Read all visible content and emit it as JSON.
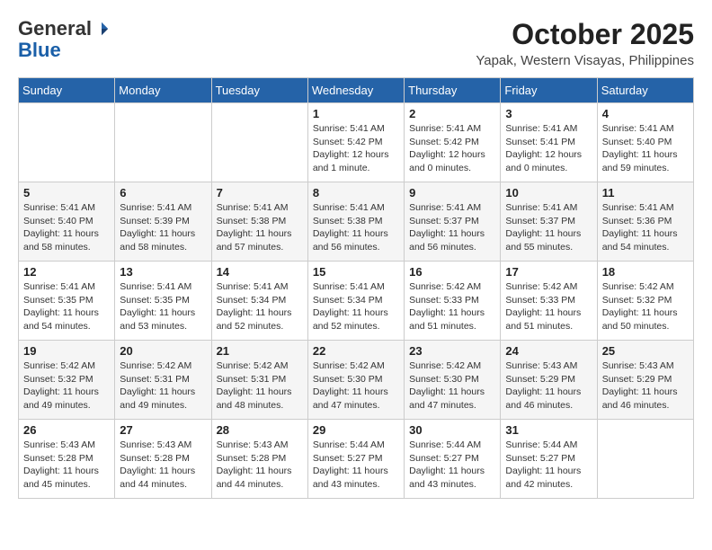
{
  "header": {
    "logo_general": "General",
    "logo_blue": "Blue",
    "month_title": "October 2025",
    "location": "Yapak, Western Visayas, Philippines"
  },
  "weekdays": [
    "Sunday",
    "Monday",
    "Tuesday",
    "Wednesday",
    "Thursday",
    "Friday",
    "Saturday"
  ],
  "weeks": [
    [
      {
        "day": "",
        "sunrise": "",
        "sunset": "",
        "daylight": ""
      },
      {
        "day": "",
        "sunrise": "",
        "sunset": "",
        "daylight": ""
      },
      {
        "day": "",
        "sunrise": "",
        "sunset": "",
        "daylight": ""
      },
      {
        "day": "1",
        "sunrise": "Sunrise: 5:41 AM",
        "sunset": "Sunset: 5:42 PM",
        "daylight": "Daylight: 12 hours and 1 minute."
      },
      {
        "day": "2",
        "sunrise": "Sunrise: 5:41 AM",
        "sunset": "Sunset: 5:42 PM",
        "daylight": "Daylight: 12 hours and 0 minutes."
      },
      {
        "day": "3",
        "sunrise": "Sunrise: 5:41 AM",
        "sunset": "Sunset: 5:41 PM",
        "daylight": "Daylight: 12 hours and 0 minutes."
      },
      {
        "day": "4",
        "sunrise": "Sunrise: 5:41 AM",
        "sunset": "Sunset: 5:40 PM",
        "daylight": "Daylight: 11 hours and 59 minutes."
      }
    ],
    [
      {
        "day": "5",
        "sunrise": "Sunrise: 5:41 AM",
        "sunset": "Sunset: 5:40 PM",
        "daylight": "Daylight: 11 hours and 58 minutes."
      },
      {
        "day": "6",
        "sunrise": "Sunrise: 5:41 AM",
        "sunset": "Sunset: 5:39 PM",
        "daylight": "Daylight: 11 hours and 58 minutes."
      },
      {
        "day": "7",
        "sunrise": "Sunrise: 5:41 AM",
        "sunset": "Sunset: 5:38 PM",
        "daylight": "Daylight: 11 hours and 57 minutes."
      },
      {
        "day": "8",
        "sunrise": "Sunrise: 5:41 AM",
        "sunset": "Sunset: 5:38 PM",
        "daylight": "Daylight: 11 hours and 56 minutes."
      },
      {
        "day": "9",
        "sunrise": "Sunrise: 5:41 AM",
        "sunset": "Sunset: 5:37 PM",
        "daylight": "Daylight: 11 hours and 56 minutes."
      },
      {
        "day": "10",
        "sunrise": "Sunrise: 5:41 AM",
        "sunset": "Sunset: 5:37 PM",
        "daylight": "Daylight: 11 hours and 55 minutes."
      },
      {
        "day": "11",
        "sunrise": "Sunrise: 5:41 AM",
        "sunset": "Sunset: 5:36 PM",
        "daylight": "Daylight: 11 hours and 54 minutes."
      }
    ],
    [
      {
        "day": "12",
        "sunrise": "Sunrise: 5:41 AM",
        "sunset": "Sunset: 5:35 PM",
        "daylight": "Daylight: 11 hours and 54 minutes."
      },
      {
        "day": "13",
        "sunrise": "Sunrise: 5:41 AM",
        "sunset": "Sunset: 5:35 PM",
        "daylight": "Daylight: 11 hours and 53 minutes."
      },
      {
        "day": "14",
        "sunrise": "Sunrise: 5:41 AM",
        "sunset": "Sunset: 5:34 PM",
        "daylight": "Daylight: 11 hours and 52 minutes."
      },
      {
        "day": "15",
        "sunrise": "Sunrise: 5:41 AM",
        "sunset": "Sunset: 5:34 PM",
        "daylight": "Daylight: 11 hours and 52 minutes."
      },
      {
        "day": "16",
        "sunrise": "Sunrise: 5:42 AM",
        "sunset": "Sunset: 5:33 PM",
        "daylight": "Daylight: 11 hours and 51 minutes."
      },
      {
        "day": "17",
        "sunrise": "Sunrise: 5:42 AM",
        "sunset": "Sunset: 5:33 PM",
        "daylight": "Daylight: 11 hours and 51 minutes."
      },
      {
        "day": "18",
        "sunrise": "Sunrise: 5:42 AM",
        "sunset": "Sunset: 5:32 PM",
        "daylight": "Daylight: 11 hours and 50 minutes."
      }
    ],
    [
      {
        "day": "19",
        "sunrise": "Sunrise: 5:42 AM",
        "sunset": "Sunset: 5:32 PM",
        "daylight": "Daylight: 11 hours and 49 minutes."
      },
      {
        "day": "20",
        "sunrise": "Sunrise: 5:42 AM",
        "sunset": "Sunset: 5:31 PM",
        "daylight": "Daylight: 11 hours and 49 minutes."
      },
      {
        "day": "21",
        "sunrise": "Sunrise: 5:42 AM",
        "sunset": "Sunset: 5:31 PM",
        "daylight": "Daylight: 11 hours and 48 minutes."
      },
      {
        "day": "22",
        "sunrise": "Sunrise: 5:42 AM",
        "sunset": "Sunset: 5:30 PM",
        "daylight": "Daylight: 11 hours and 47 minutes."
      },
      {
        "day": "23",
        "sunrise": "Sunrise: 5:42 AM",
        "sunset": "Sunset: 5:30 PM",
        "daylight": "Daylight: 11 hours and 47 minutes."
      },
      {
        "day": "24",
        "sunrise": "Sunrise: 5:43 AM",
        "sunset": "Sunset: 5:29 PM",
        "daylight": "Daylight: 11 hours and 46 minutes."
      },
      {
        "day": "25",
        "sunrise": "Sunrise: 5:43 AM",
        "sunset": "Sunset: 5:29 PM",
        "daylight": "Daylight: 11 hours and 46 minutes."
      }
    ],
    [
      {
        "day": "26",
        "sunrise": "Sunrise: 5:43 AM",
        "sunset": "Sunset: 5:28 PM",
        "daylight": "Daylight: 11 hours and 45 minutes."
      },
      {
        "day": "27",
        "sunrise": "Sunrise: 5:43 AM",
        "sunset": "Sunset: 5:28 PM",
        "daylight": "Daylight: 11 hours and 44 minutes."
      },
      {
        "day": "28",
        "sunrise": "Sunrise: 5:43 AM",
        "sunset": "Sunset: 5:28 PM",
        "daylight": "Daylight: 11 hours and 44 minutes."
      },
      {
        "day": "29",
        "sunrise": "Sunrise: 5:44 AM",
        "sunset": "Sunset: 5:27 PM",
        "daylight": "Daylight: 11 hours and 43 minutes."
      },
      {
        "day": "30",
        "sunrise": "Sunrise: 5:44 AM",
        "sunset": "Sunset: 5:27 PM",
        "daylight": "Daylight: 11 hours and 43 minutes."
      },
      {
        "day": "31",
        "sunrise": "Sunrise: 5:44 AM",
        "sunset": "Sunset: 5:27 PM",
        "daylight": "Daylight: 11 hours and 42 minutes."
      },
      {
        "day": "",
        "sunrise": "",
        "sunset": "",
        "daylight": ""
      }
    ]
  ]
}
